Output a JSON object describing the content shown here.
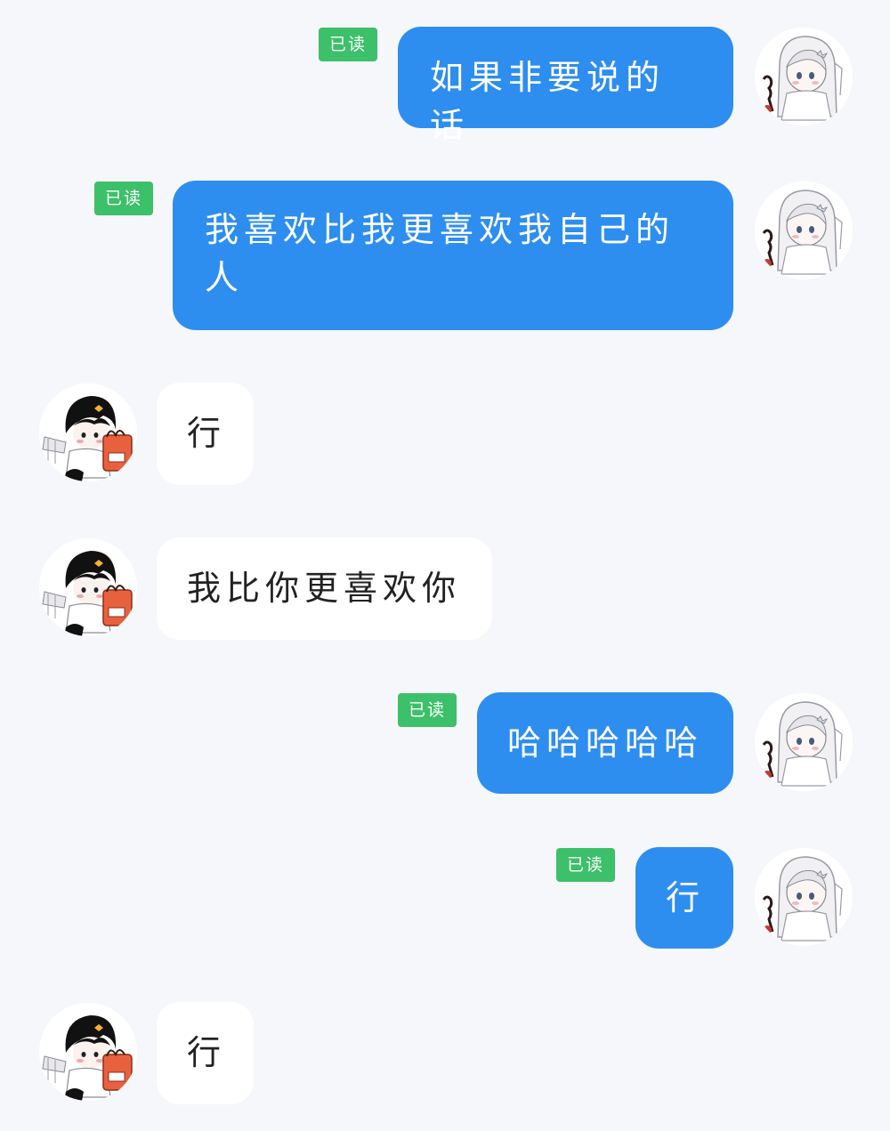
{
  "theme": {
    "background": "#f5f7fa",
    "self_bubble": "#2d8ef0",
    "other_bubble": "#ffffff",
    "read_badge": "#3cc06a"
  },
  "messages": [
    {
      "sender": "self",
      "text": "如果非要说的话",
      "status": "已读",
      "avatar": "girl-avatar-icon"
    },
    {
      "sender": "self",
      "text": "我喜欢比我更喜欢我自己的人",
      "status": "已读",
      "avatar": "girl-avatar-icon"
    },
    {
      "sender": "other",
      "text": "行",
      "avatar": "boy-avatar-icon"
    },
    {
      "sender": "other",
      "text": "我比你更喜欢你",
      "avatar": "boy-avatar-icon"
    },
    {
      "sender": "self",
      "text": "哈哈哈哈哈",
      "status": "已读",
      "avatar": "girl-avatar-icon"
    },
    {
      "sender": "self",
      "text": "行",
      "status": "已读",
      "avatar": "girl-avatar-icon"
    },
    {
      "sender": "other",
      "text": "行",
      "avatar": "boy-avatar-icon"
    }
  ]
}
